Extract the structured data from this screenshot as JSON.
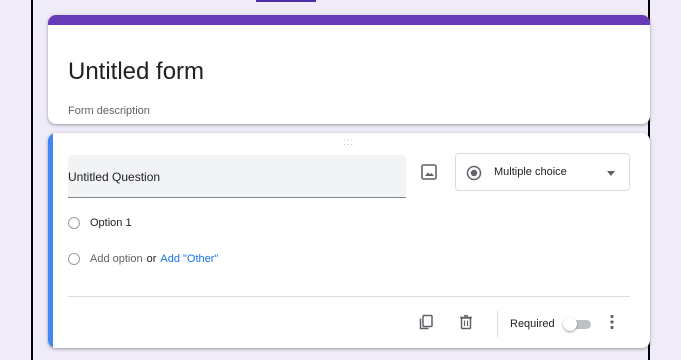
{
  "form": {
    "title": "Untitled form",
    "description_placeholder": "Form description"
  },
  "question": {
    "drag_handle": ":::",
    "title": "Untitled Question",
    "type_select": {
      "selected": "Multiple choice",
      "icon": "radio-button-icon"
    },
    "options": [
      {
        "label": "Option 1"
      }
    ],
    "add_option": {
      "label": "Add option",
      "or": "or",
      "add_other": "Add \"Other\""
    },
    "footer": {
      "duplicate_icon": "copy-icon",
      "delete_icon": "trash-icon",
      "required_label": "Required",
      "required_on": false,
      "more_icon": "more-vert-icon"
    }
  },
  "colors": {
    "background": "#f0ebf8",
    "title_accent": "#673ab7",
    "question_accent": "#4285f4",
    "link": "#1a73e8"
  }
}
